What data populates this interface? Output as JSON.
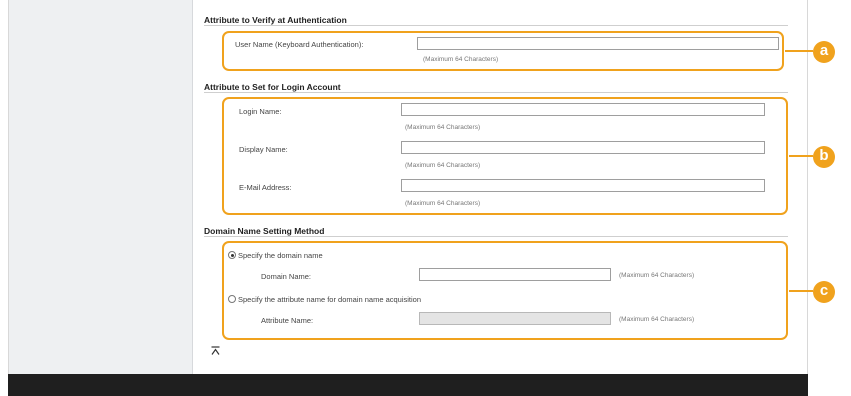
{
  "sections": {
    "verify": {
      "title": "Attribute to Verify at Authentication",
      "user_name_label": "User Name (Keyboard Authentication):",
      "user_name_value": "",
      "user_name_hint": "(Maximum 64 Characters)"
    },
    "login": {
      "title": "Attribute to Set for Login Account",
      "login_name_label": "Login Name:",
      "login_name_value": "",
      "login_name_hint": "(Maximum 64 Characters)",
      "display_name_label": "Display Name:",
      "display_name_value": "",
      "display_name_hint": "(Maximum 64 Characters)",
      "email_label": "E-Mail Address:",
      "email_value": "",
      "email_hint": "(Maximum 64 Characters)"
    },
    "domain": {
      "title": "Domain Name Setting Method",
      "option_specify_label": "Specify the domain name",
      "option_specify_checked": true,
      "domain_name_label": "Domain Name:",
      "domain_name_value": "",
      "domain_name_hint": "(Maximum 64 Characters)",
      "option_attribute_label": "Specify the attribute name for domain name acquisition",
      "option_attribute_checked": false,
      "attribute_name_label": "Attribute Name:",
      "attribute_name_value": "",
      "attribute_name_hint": "(Maximum 64 Characters)"
    }
  },
  "callouts": [
    "a",
    "b",
    "c"
  ],
  "colors": {
    "callout": "#f0a21d",
    "bottom_bar": "#1f1f1f",
    "left_panel": "#eef0f2"
  },
  "icons": {
    "scroll_top": "scroll-to-top-icon"
  }
}
